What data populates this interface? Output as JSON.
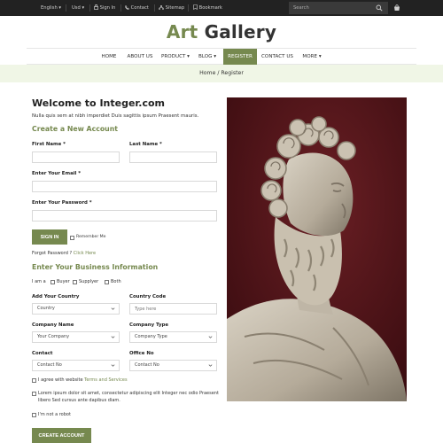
{
  "topbar": {
    "language": "English",
    "currency": "Usd",
    "sign_in": "Sign In",
    "contact": "Contact",
    "sitemap": "Sitemap",
    "bookmark": "Bookmark",
    "search_placeholder": "Search"
  },
  "brand": {
    "word1": "Art",
    "word2": "Gallery",
    "accent_color": "#76894f"
  },
  "nav": {
    "items": [
      "HOME",
      "ABOUT US",
      "PRODUCT",
      "BLOG",
      "REGISTER",
      "CONTACT US",
      "MORE"
    ],
    "active": "REGISTER"
  },
  "breadcrumb": "Home / Register",
  "form": {
    "title": "Welcome to Integer.com",
    "subtitle": "Nulla quis sem at nibh imperdiet Duis sagittis ipsum Praesent mauris.",
    "account_heading": "Create a New Account",
    "first_name_label": "First Name *",
    "last_name_label": "Last Name *",
    "email_label": "Enter Your Email *",
    "password_label": "Enter Your Password *",
    "sign_in_button": "SIGN IN",
    "remember_me": "Remember Me",
    "forgot_text": "Forgot Password ?",
    "forgot_link": "Click Here",
    "business_heading": "Enter Your Business Information",
    "i_am_a": "I am a",
    "role_buyer": "Buyer",
    "role_supplier": "Supplyer",
    "role_both": "Both",
    "country_label": "Add Your Country",
    "country_value": "Country",
    "country_code_label": "Country Code",
    "country_code_placeholder": "Type here",
    "company_name_label": "Company Name",
    "company_name_value": "Your Company",
    "company_type_label": "Company Type",
    "company_type_value": "Company Type",
    "contact_label": "Contact",
    "contact_value": "Contact No",
    "office_label": "Office No",
    "office_value": "Contact No",
    "agree_text": "I agree with website",
    "agree_link": "Terms and Services",
    "lorem_text": "Lorem ipsum dolor sit amet, consectetur adipiscing elit Integer nec odio Praesent libero Sed cursus ante dapibus diam.",
    "robot_text": "I'm not a robot",
    "create_button": "CREATE ACCOUNT"
  }
}
